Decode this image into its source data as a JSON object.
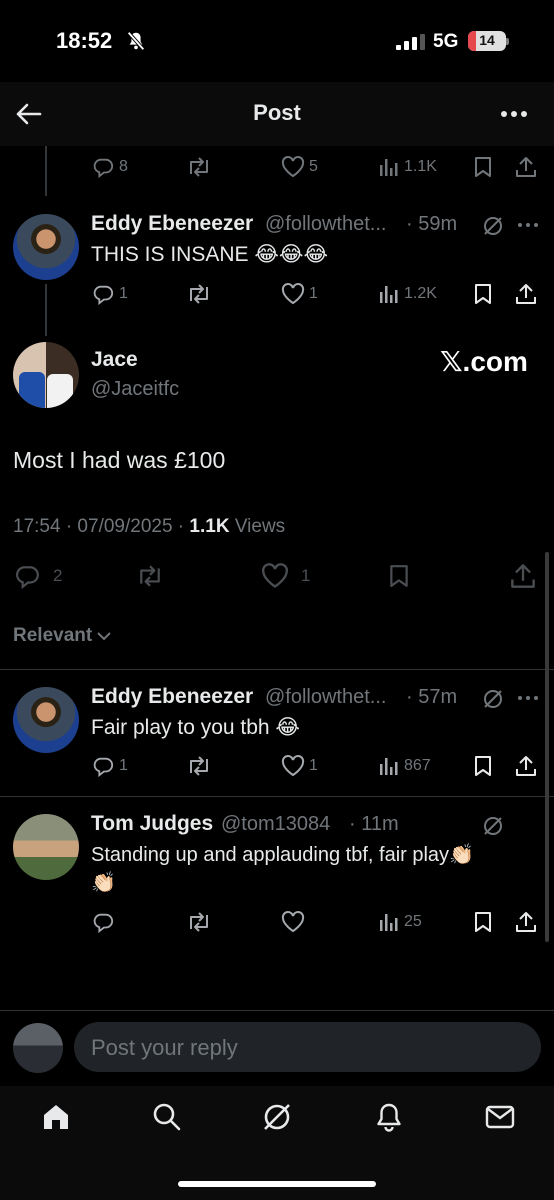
{
  "status_bar": {
    "time": "18:52",
    "network": "5G",
    "battery": "14"
  },
  "header": {
    "title": "Post"
  },
  "top_actions": {
    "replies": "8",
    "reposts": "",
    "likes": "5",
    "views": "1.1K"
  },
  "reply_1": {
    "name": "Eddy Ebeneezer",
    "handle": "@followthet...",
    "time": "· 59m",
    "text": "THIS IS INSANE 😂😂😂",
    "replies": "1",
    "likes": "1",
    "views": "1.2K"
  },
  "main_post": {
    "name": "Jace",
    "handle": "@Jaceitfc",
    "watermark": "𝕏.com",
    "text": "Most I had was £100",
    "timestamp": "17:54 · 07/09/2025 ·",
    "views_count": "1.1K",
    "views_label": "Views",
    "replies": "2",
    "likes": "1"
  },
  "sort": {
    "label": "Relevant"
  },
  "reply_2": {
    "name": "Eddy Ebeneezer",
    "handle": "@followthet...",
    "time": "· 57m",
    "text": "Fair play to you tbh 😂",
    "replies": "1",
    "likes": "1",
    "views": "867"
  },
  "reply_3": {
    "name": "Tom Judges",
    "handle": "@tom13084",
    "time": "· 11m",
    "text_line1": "Standing up and applauding tbf, fair play👏🏻",
    "text_line2": "👏🏻",
    "views": "25"
  },
  "composer": {
    "placeholder": "Post your reply"
  },
  "colors": {
    "background": "#000000",
    "text": "#e7e9ea",
    "muted": "#71767b",
    "divider": "#2f3336",
    "battery_low": "#e5484d"
  },
  "icons": [
    "back-arrow-icon",
    "more-icon",
    "reply-icon",
    "repost-icon",
    "like-icon",
    "views-icon",
    "bookmark-icon",
    "share-icon",
    "grok-icon",
    "home-icon",
    "search-icon",
    "notifications-icon",
    "messages-icon"
  ]
}
